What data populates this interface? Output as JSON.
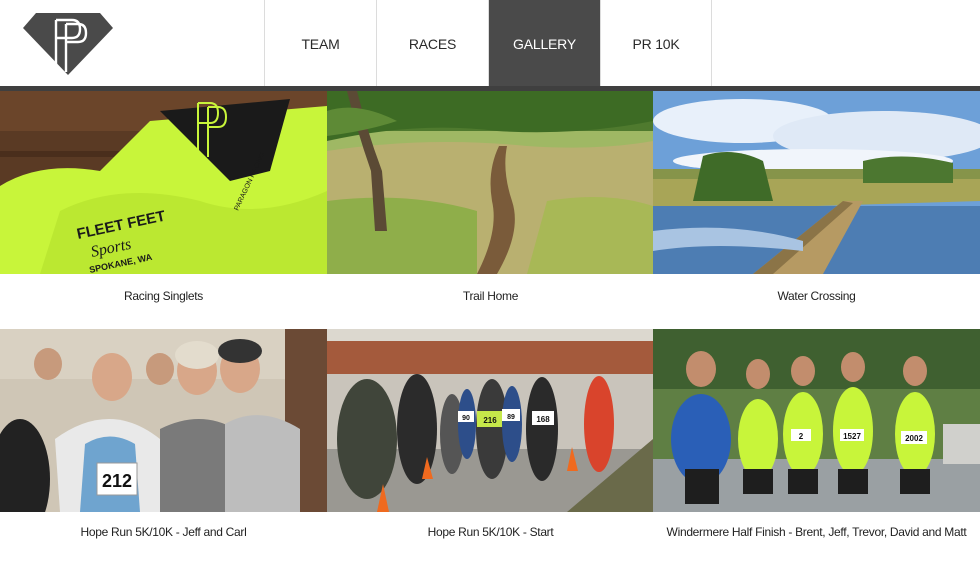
{
  "nav": {
    "items": [
      {
        "label": "TEAM"
      },
      {
        "label": "RACES"
      },
      {
        "label": "GALLERY"
      },
      {
        "label": "PR 10K"
      }
    ]
  },
  "gallery": {
    "items": [
      {
        "caption": "Racing Singlets",
        "shirt_text_1": "FLEET FEET",
        "shirt_text_2": "Sports",
        "shirt_text_3": "SPOKANE, WA",
        "shirt_brand": "PARAGON RACING"
      },
      {
        "caption": "Trail Home"
      },
      {
        "caption": "Water Crossing"
      },
      {
        "caption": "Hope Run 5K/10K - Jeff and Carl",
        "bib": "212"
      },
      {
        "caption": "Hope Run 5K/10K - Start",
        "bib_1": "216",
        "bib_2": "168",
        "bib_3": "89",
        "bib_4": "90"
      },
      {
        "caption": "Windermere Half Finish - Brent, Jeff, Trevor, David and Matt",
        "bib_1": "2",
        "bib_2": "1527",
        "bib_3": "2002"
      }
    ]
  },
  "colors": {
    "nav_active_bg": "#4a4a4a",
    "rule": "#3f3f3f",
    "singlet": "#c8f53a"
  }
}
